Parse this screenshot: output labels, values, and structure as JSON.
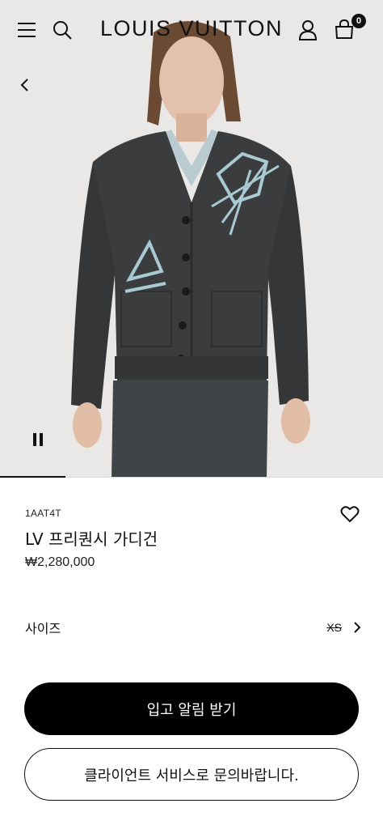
{
  "header": {
    "brand": "LOUIS VUITTON",
    "bag_count": "0",
    "icons": [
      "menu-icon",
      "search-icon",
      "account-icon",
      "shopping-bag-icon"
    ]
  },
  "gallery": {
    "back_icon": "chevron-left-icon",
    "pause_icon": "pause-icon",
    "progress": 0.17
  },
  "product": {
    "sku": "1AAT4T",
    "title": "LV 프리퀀시 가디건",
    "price": "₩2,280,000",
    "wishlist_icon": "heart-outline-icon"
  },
  "size": {
    "label": "사이즈",
    "value": "XS"
  },
  "actions": {
    "notify_label": "입고 알림 받기",
    "contact_label": "클라이언트 서비스로 문의바랍니다."
  },
  "colors": {
    "accent": "#000000",
    "background": "#ffffff",
    "hero_bg": "#eae9e8"
  }
}
